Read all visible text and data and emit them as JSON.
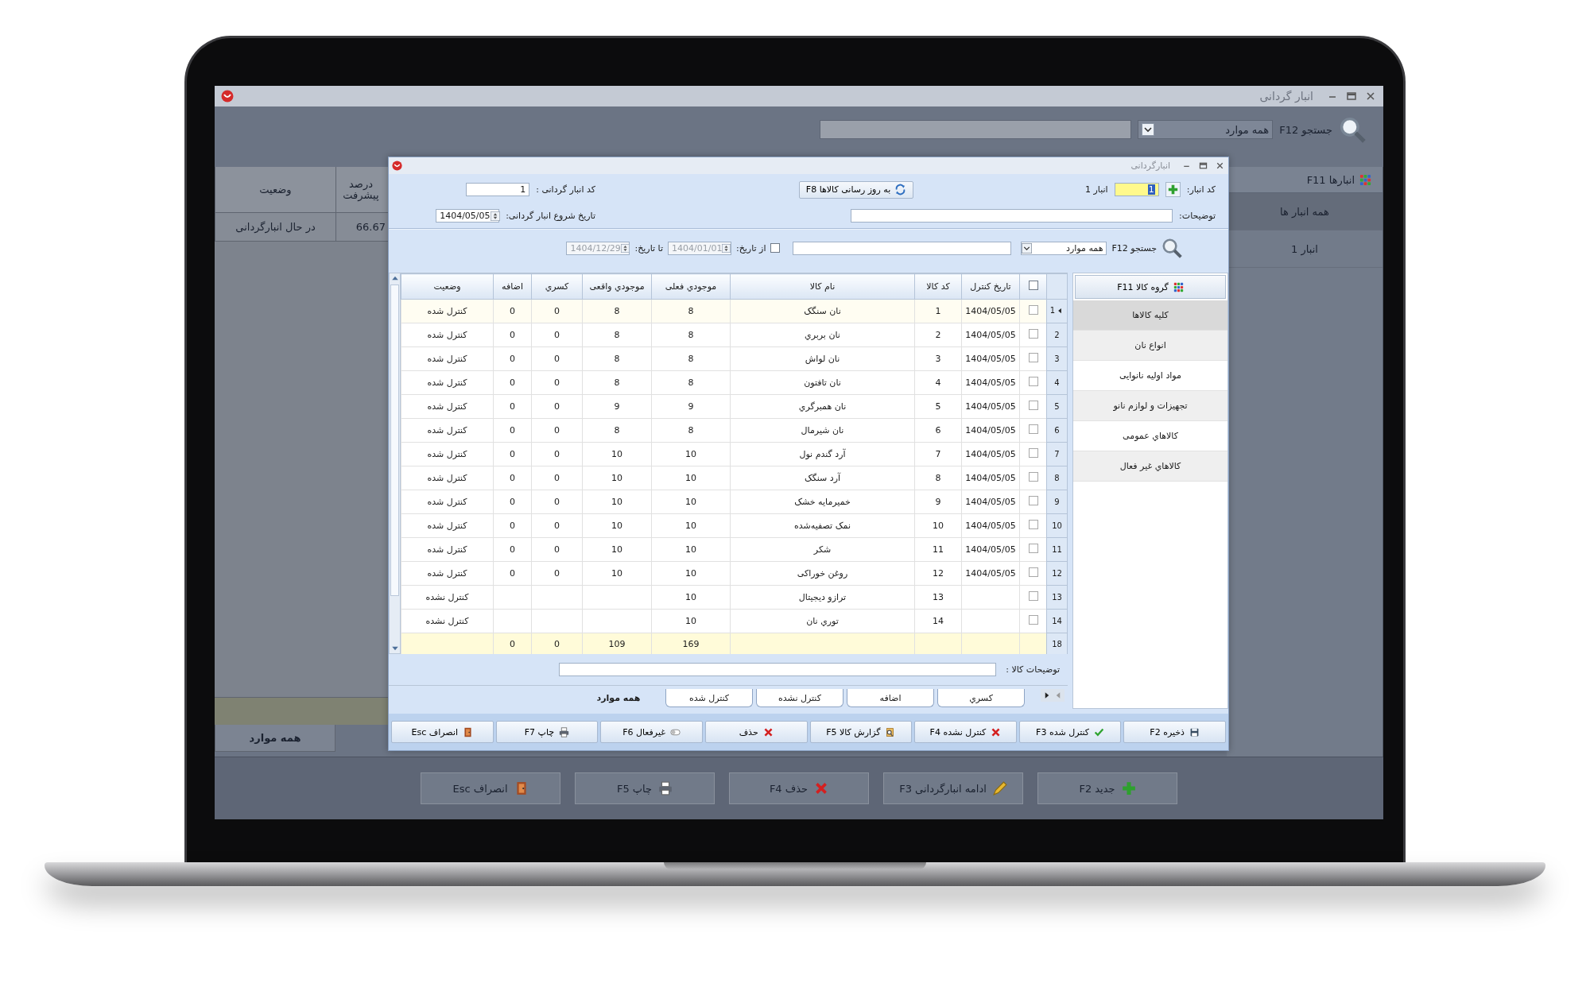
{
  "background_window": {
    "title": "انبار گردانی",
    "search": {
      "label": "جستجو F12",
      "filter": "همه موارد"
    },
    "warehouses": {
      "header": "انبارها F11",
      "items": [
        {
          "label": "همه انبار ها",
          "selected": true
        },
        {
          "label": "انبار 1",
          "selected": false
        }
      ]
    },
    "table": {
      "columns": [
        "درصد پیشرفت",
        "وضعیت"
      ],
      "rows": [
        {
          "progress": "66.67",
          "status": "در حال انبارگردانی"
        }
      ]
    },
    "tabs": [
      {
        "label": "همه موارد",
        "selected": true
      }
    ],
    "buttons": [
      "جدید F2",
      "ادامه انبارگردانی F3",
      "حذف F4",
      "چاپ F5",
      "انصراف Esc"
    ]
  },
  "dialog": {
    "title": "انبارگردانی",
    "warehouse": {
      "label": "کد انبار:",
      "value": "1",
      "name": "انبار 1"
    },
    "refresh_button": "به روز رسانی کالاها F8",
    "count_code": {
      "label": "کد انبار گردانی :",
      "value": "1"
    },
    "description": {
      "label": "توضیحات:"
    },
    "start_date": {
      "label": "تاریخ شروع انبار گردانی:",
      "value": "1404/05/05"
    },
    "search": {
      "label": "جستجو F12",
      "filter": "همه موارد"
    },
    "date_filter": {
      "checked": false,
      "from_label": "از تاریخ:",
      "from": "1404/01/01",
      "to_label": "تا تاریخ:",
      "to": "1404/12/29"
    },
    "group_button": "گروه کالا F11",
    "groups": [
      {
        "label": "کلیه کالاها",
        "selected": true
      },
      {
        "label": "انواع نان",
        "selected": false
      },
      {
        "label": "مواد اولیه نانوایی",
        "selected": false
      },
      {
        "label": "تجهیزات و لوازم نانو",
        "selected": false
      },
      {
        "label": "کالاهاي عمومی",
        "selected": false
      },
      {
        "label": "کالاهاي غیر فعال",
        "selected": false
      }
    ],
    "table": {
      "select_all": {
        "checked": false
      },
      "columns": [
        "تاریخ کنترل",
        "کد کالا",
        "نام کالا",
        "موجودي فعلی",
        "موجودي واقعی",
        "کسري",
        "اضافه",
        "وضعیت"
      ],
      "rows": [
        {
          "n": "1",
          "selected": true,
          "checked": false,
          "date": "1404/05/05",
          "code": "1",
          "name": "نان سنگک",
          "current": "8",
          "actual": "8",
          "shortage": "0",
          "surplus": "0",
          "status": "کنترل شده"
        },
        {
          "n": "2",
          "selected": false,
          "checked": false,
          "date": "1404/05/05",
          "code": "2",
          "name": "نان بربري",
          "current": "8",
          "actual": "8",
          "shortage": "0",
          "surplus": "0",
          "status": "کنترل شده"
        },
        {
          "n": "3",
          "selected": false,
          "checked": false,
          "date": "1404/05/05",
          "code": "3",
          "name": "نان لواش",
          "current": "8",
          "actual": "8",
          "shortage": "0",
          "surplus": "0",
          "status": "کنترل شده"
        },
        {
          "n": "4",
          "selected": false,
          "checked": false,
          "date": "1404/05/05",
          "code": "4",
          "name": "نان تافتون",
          "current": "8",
          "actual": "8",
          "shortage": "0",
          "surplus": "0",
          "status": "کنترل شده"
        },
        {
          "n": "5",
          "selected": false,
          "checked": false,
          "date": "1404/05/05",
          "code": "5",
          "name": "نان همبرگري",
          "current": "9",
          "actual": "9",
          "shortage": "0",
          "surplus": "0",
          "status": "کنترل شده"
        },
        {
          "n": "6",
          "selected": false,
          "checked": false,
          "date": "1404/05/05",
          "code": "6",
          "name": "نان شیرمال",
          "current": "8",
          "actual": "8",
          "shortage": "0",
          "surplus": "0",
          "status": "کنترل شده"
        },
        {
          "n": "7",
          "selected": false,
          "checked": false,
          "date": "1404/05/05",
          "code": "7",
          "name": "آرد گندم نول",
          "current": "10",
          "actual": "10",
          "shortage": "0",
          "surplus": "0",
          "status": "کنترل شده"
        },
        {
          "n": "8",
          "selected": false,
          "checked": false,
          "date": "1404/05/05",
          "code": "8",
          "name": "آرد سنگک",
          "current": "10",
          "actual": "10",
          "shortage": "0",
          "surplus": "0",
          "status": "کنترل شده"
        },
        {
          "n": "9",
          "selected": false,
          "checked": false,
          "date": "1404/05/05",
          "code": "9",
          "name": "خمیرمایه خشک",
          "current": "10",
          "actual": "10",
          "shortage": "0",
          "surplus": "0",
          "status": "کنترل شده"
        },
        {
          "n": "10",
          "selected": false,
          "checked": false,
          "date": "1404/05/05",
          "code": "10",
          "name": "نمک تصفیه‌شده",
          "current": "10",
          "actual": "10",
          "shortage": "0",
          "surplus": "0",
          "status": "کنترل شده"
        },
        {
          "n": "11",
          "selected": false,
          "checked": false,
          "date": "1404/05/05",
          "code": "11",
          "name": "شکر",
          "current": "10",
          "actual": "10",
          "shortage": "0",
          "surplus": "0",
          "status": "کنترل شده"
        },
        {
          "n": "12",
          "selected": false,
          "checked": false,
          "date": "1404/05/05",
          "code": "12",
          "name": "روغن خوراکی",
          "current": "10",
          "actual": "10",
          "shortage": "0",
          "surplus": "0",
          "status": "کنترل شده"
        },
        {
          "n": "13",
          "selected": false,
          "checked": false,
          "code": "13",
          "name": "ترازو دیجیتال",
          "current": "10",
          "status": "کنترل نشده"
        },
        {
          "n": "14",
          "selected": false,
          "checked": false,
          "code": "14",
          "name": "توري نان",
          "current": "10",
          "status": "کنترل نشده"
        }
      ],
      "footer": {
        "n": "18",
        "current": "169",
        "actual": "109",
        "shortage": "0",
        "surplus": "0"
      }
    },
    "item_description": {
      "label": "توضیحات کالا :"
    },
    "tabs": [
      {
        "label": "کسري",
        "selected": false
      },
      {
        "label": "اضافه",
        "selected": false
      },
      {
        "label": "کنترل نشده",
        "selected": false
      },
      {
        "label": "کنترل شده",
        "selected": false
      },
      {
        "label": "همه موارد",
        "selected": true
      }
    ],
    "buttons": [
      "ذخیره F2",
      "کنترل شده F3",
      "کنترل نشده F4",
      "گزارش کالا F5",
      "حذف",
      "غیرفعال F6",
      "چاپ F7",
      "انصراف Esc"
    ]
  }
}
